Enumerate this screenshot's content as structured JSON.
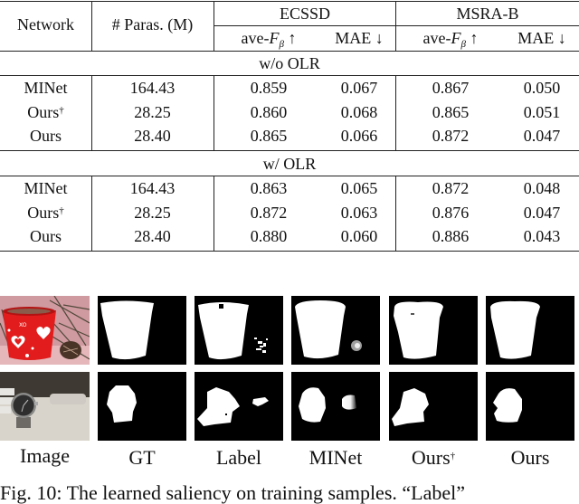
{
  "table": {
    "headers": {
      "network": "Network",
      "params": "# Paras. (M)",
      "dataset1": "ECSSD",
      "dataset2": "MSRA-B",
      "metric_f_prefix": "ave-",
      "metric_f_symbol": "F",
      "metric_f_sub": "β",
      "up_arrow": "↑",
      "metric_mae": "MAE",
      "down_arrow": "↓"
    },
    "sections": [
      {
        "title": "w/o OLR",
        "rows": [
          {
            "network": "MINet",
            "dagger": "",
            "params": "164.43",
            "ecssd_f": "0.859",
            "ecssd_mae": "0.067",
            "msra_f": "0.867",
            "msra_mae": "0.050"
          },
          {
            "network": "Ours",
            "dagger": "†",
            "params": "28.25",
            "ecssd_f": "0.860",
            "ecssd_mae": "0.068",
            "msra_f": "0.865",
            "msra_mae": "0.051"
          },
          {
            "network": "Ours",
            "dagger": "",
            "params": "28.40",
            "ecssd_f": "0.865",
            "ecssd_mae": "0.066",
            "msra_f": "0.872",
            "msra_mae": "0.047"
          }
        ]
      },
      {
        "title": "w/ OLR",
        "rows": [
          {
            "network": "MINet",
            "dagger": "",
            "params": "164.43",
            "ecssd_f": "0.863",
            "ecssd_mae": "0.065",
            "msra_f": "0.872",
            "msra_mae": "0.048"
          },
          {
            "network": "Ours",
            "dagger": "†",
            "params": "28.25",
            "ecssd_f": "0.872",
            "ecssd_mae": "0.063",
            "msra_f": "0.876",
            "msra_mae": "0.047"
          },
          {
            "network": "Ours",
            "dagger": "",
            "params": "28.40",
            "ecssd_f": "0.880",
            "ecssd_mae": "0.060",
            "msra_f": "0.886",
            "msra_mae": "0.043"
          }
        ]
      }
    ]
  },
  "figure": {
    "columns": [
      {
        "label": "Image",
        "dagger": ""
      },
      {
        "label": "GT",
        "dagger": ""
      },
      {
        "label": "Label",
        "dagger": ""
      },
      {
        "label": "MINet",
        "dagger": ""
      },
      {
        "label": "Ours",
        "dagger": "†"
      },
      {
        "label": "Ours",
        "dagger": ""
      }
    ],
    "rows": [
      {
        "subject": "red heart candle pot with pine cone"
      },
      {
        "subject": "wristwatch on keyboard"
      }
    ]
  },
  "caption": "Fig. 10: The learned saliency on training samples. “Label”"
}
